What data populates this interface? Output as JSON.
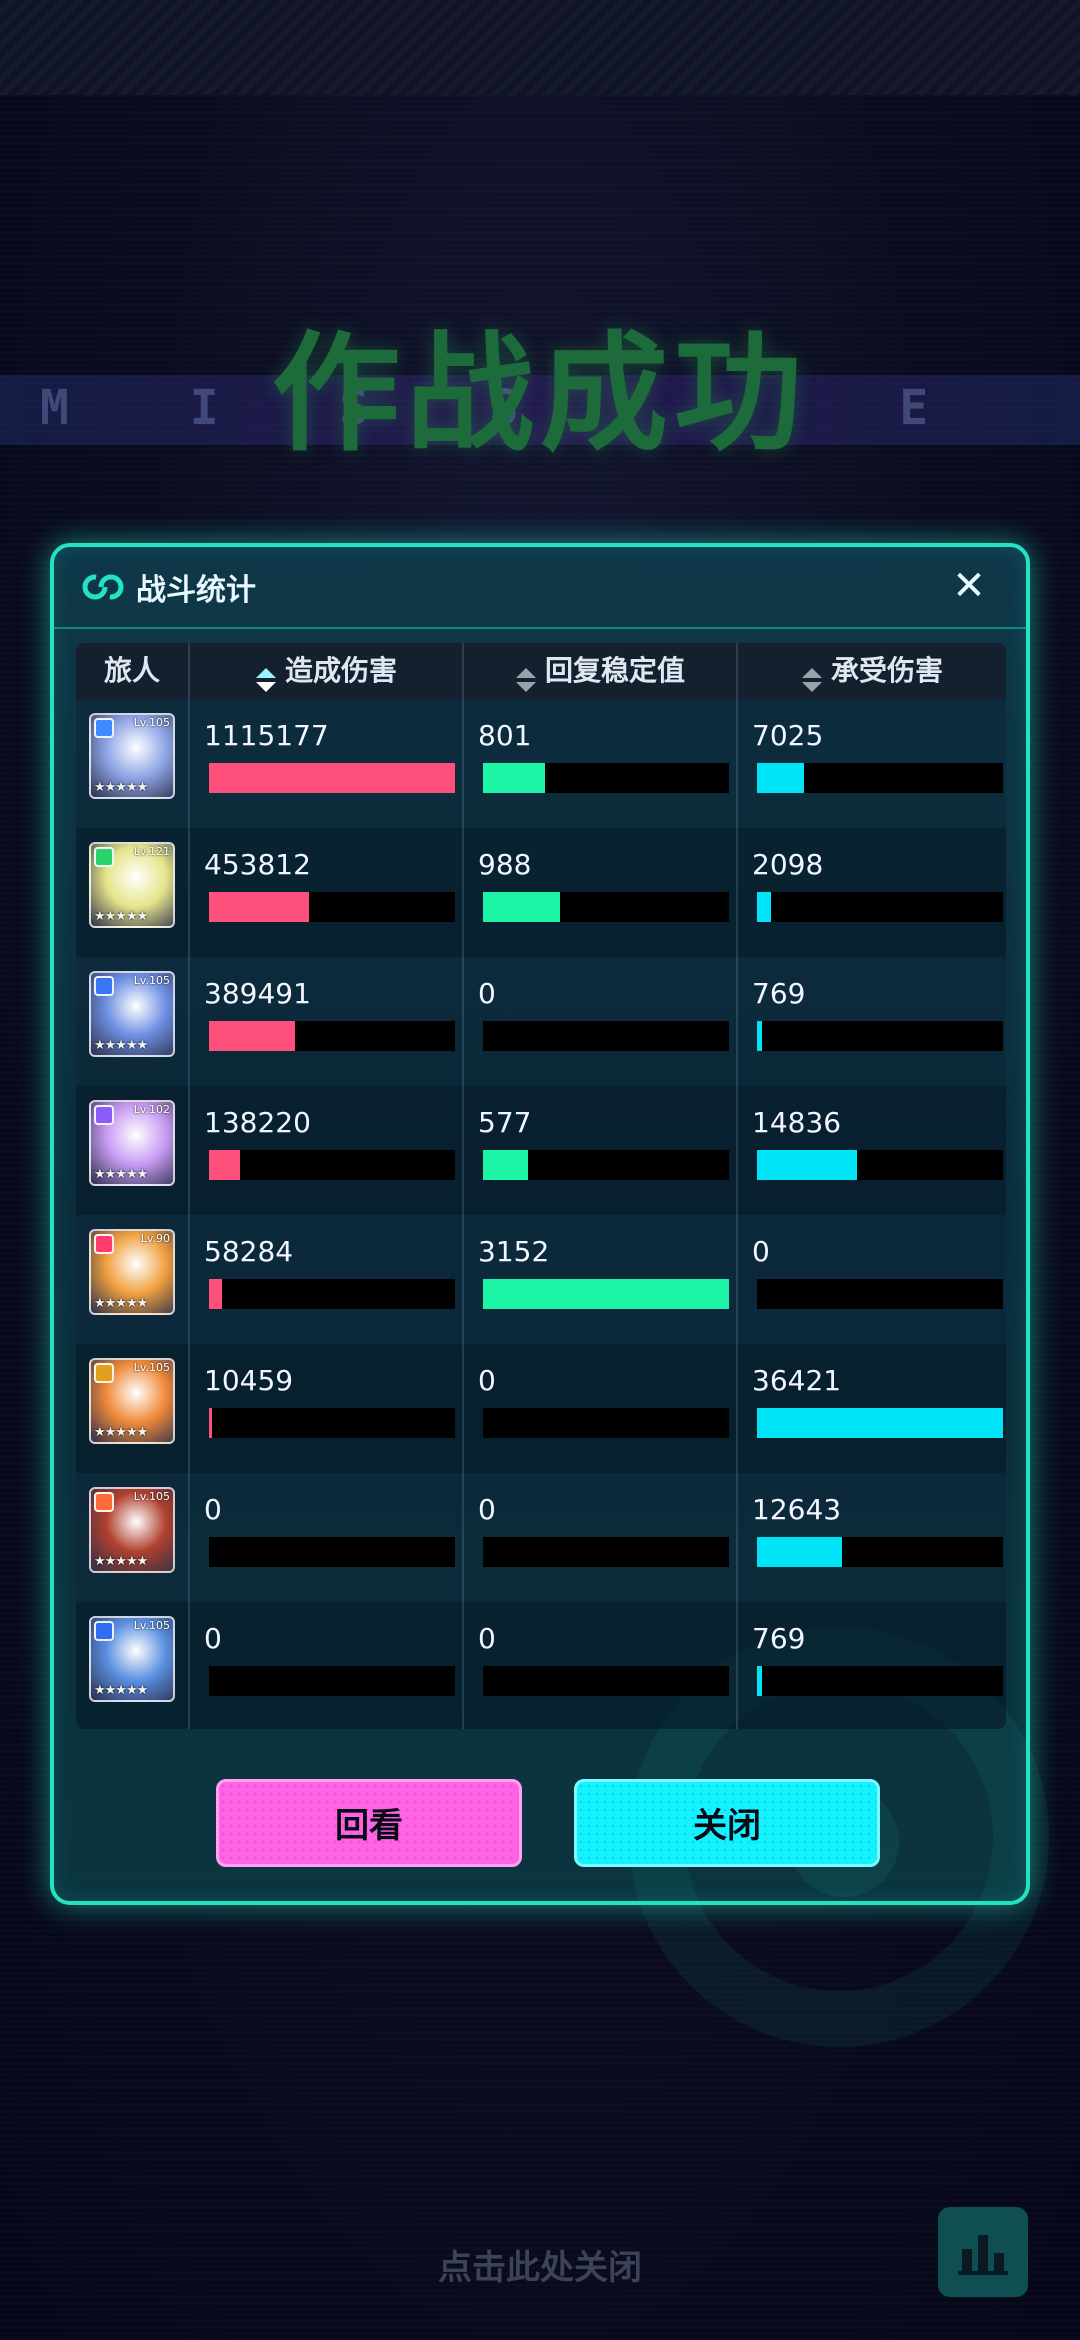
{
  "banner": {
    "title": "作战成功",
    "subtitle": "M I S S",
    "subtitle_tail": "E D"
  },
  "panel": {
    "title": "战斗统计",
    "close_icon": "close-icon"
  },
  "table": {
    "headers": {
      "traveler": "旅人",
      "damage_dealt": "造成伤害",
      "stability_restored": "回复稳定值",
      "damage_taken": "承受伤害"
    },
    "active_sort": "damage_dealt",
    "rows": [
      {
        "level": "Lv.105",
        "damage_dealt": "1115177",
        "stability_restored": "801",
        "damage_taken": "7025",
        "damage_pct": 1.0,
        "heal_pct": 0.254,
        "taken_pct": 0.193,
        "portrait": "#8fa6e6",
        "accent": "#3b8bff"
      },
      {
        "level": "Lv.121",
        "damage_dealt": "453812",
        "stability_restored": "988",
        "damage_taken": "2098",
        "damage_pct": 0.407,
        "heal_pct": 0.313,
        "taken_pct": 0.058,
        "portrait": "#e6e48a",
        "accent": "#2ad46c"
      },
      {
        "level": "Lv.105",
        "damage_dealt": "389491",
        "stability_restored": "0",
        "damage_taken": "769",
        "damage_pct": 0.349,
        "heal_pct": 0,
        "taken_pct": 0.021,
        "portrait": "#6f8fe2",
        "accent": "#3a76f0"
      },
      {
        "level": "Lv.102",
        "damage_dealt": "138220",
        "stability_restored": "577",
        "damage_taken": "14836",
        "damage_pct": 0.124,
        "heal_pct": 0.183,
        "taken_pct": 0.407,
        "portrait": "#c79bf2",
        "accent": "#8b5cf6"
      },
      {
        "level": "Lv.90",
        "damage_dealt": "58284",
        "stability_restored": "3152",
        "damage_taken": "0",
        "damage_pct": 0.052,
        "heal_pct": 1.0,
        "taken_pct": 0,
        "portrait": "#f0a040",
        "accent": "#ff3b6e"
      },
      {
        "level": "Lv.105",
        "damage_dealt": "10459",
        "stability_restored": "0",
        "damage_taken": "36421",
        "damage_pct": 0.009,
        "heal_pct": 0,
        "taken_pct": 1.0,
        "portrait": "#f08a3a",
        "accent": "#e0a020"
      },
      {
        "level": "Lv.105",
        "damage_dealt": "0",
        "stability_restored": "0",
        "damage_taken": "12643",
        "damage_pct": 0,
        "heal_pct": 0,
        "taken_pct": 0.347,
        "portrait": "#b0402e",
        "accent": "#ff6a3b"
      },
      {
        "level": "Lv.105",
        "damage_dealt": "0",
        "stability_restored": "0",
        "damage_taken": "769",
        "damage_pct": 0,
        "heal_pct": 0,
        "taken_pct": 0.021,
        "portrait": "#5a8fe0",
        "accent": "#2f6cf0"
      }
    ]
  },
  "buttons": {
    "replay": "回看",
    "close": "关闭"
  },
  "footer": {
    "tap_to_close": "点击此处关闭",
    "stats_icon": "bar-chart-icon"
  },
  "colors": {
    "accent": "#22e3c2",
    "damage": "#ff4f7b",
    "heal": "#1df5a6",
    "taken": "#00e4f7"
  }
}
